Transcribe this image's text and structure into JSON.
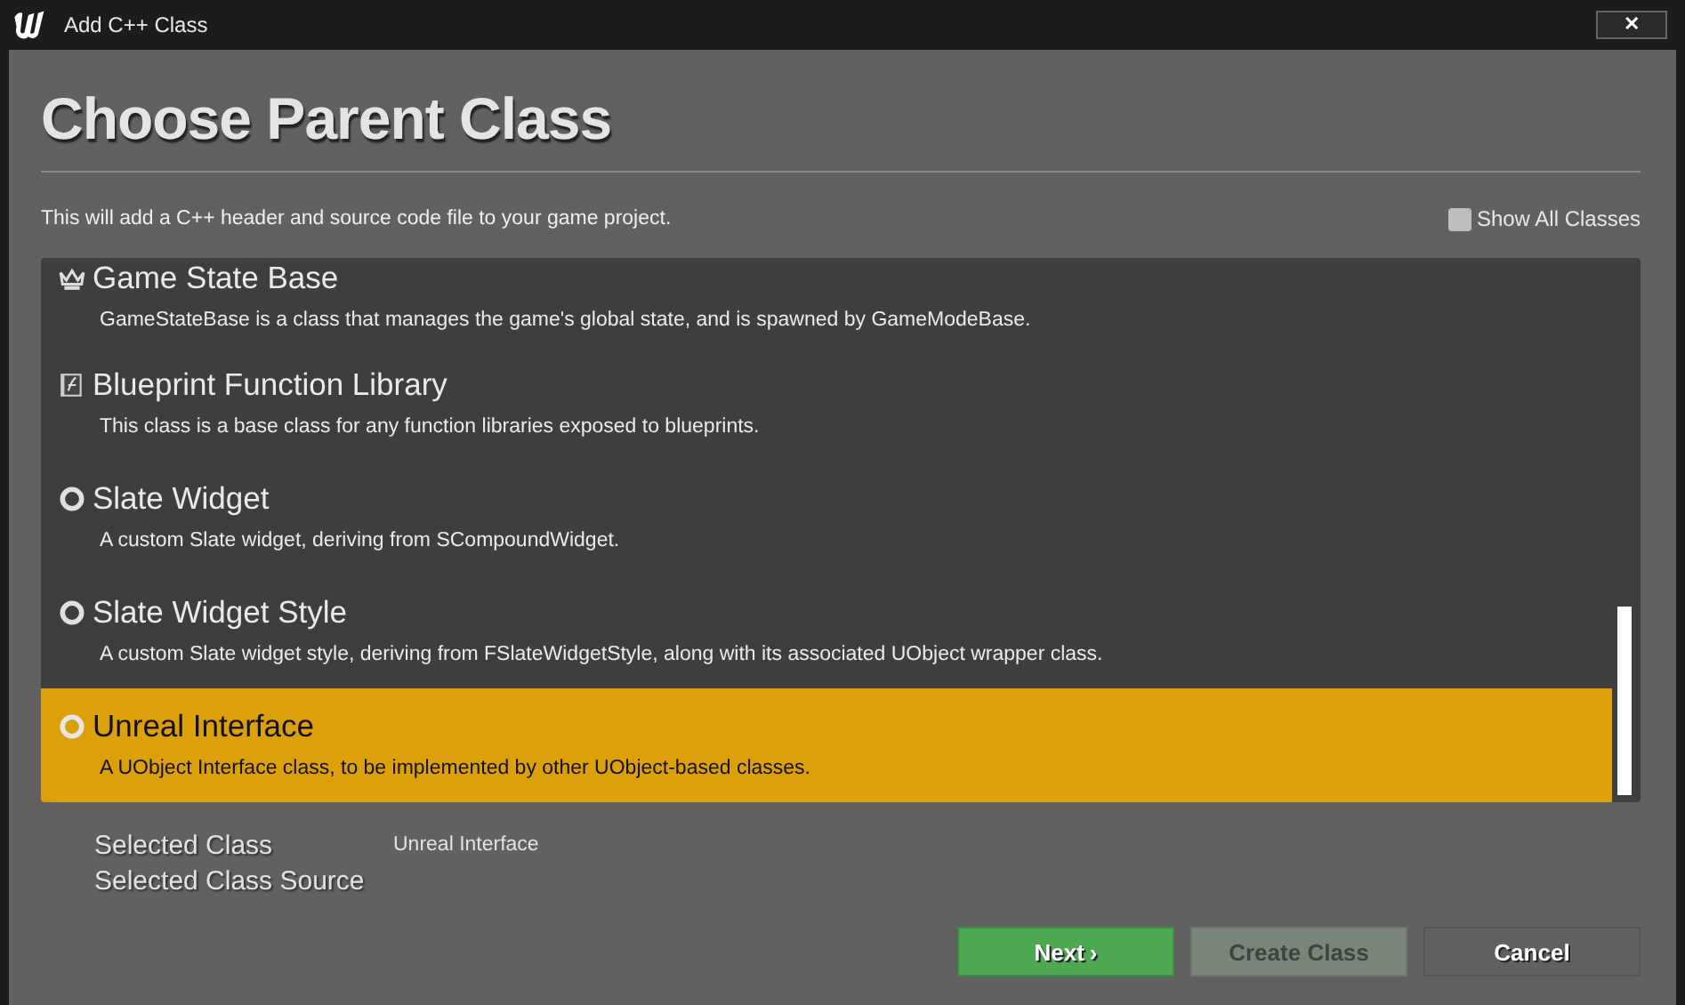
{
  "window": {
    "title": "Add C++ Class",
    "close": "✕"
  },
  "heading": "Choose Parent Class",
  "description": "This will add a C++ header and source code file to your game project.",
  "show_all_classes": {
    "label": "Show All Classes",
    "checked": false
  },
  "classes": [
    {
      "kind": "state",
      "name": "Game State Base",
      "description": "GameStateBase is a class that manages the game's global state, and is spawned by GameModeBase.",
      "selected": false
    },
    {
      "kind": "library",
      "name": "Blueprint Function Library",
      "description": "This class is a base class for any function libraries exposed to blueprints.",
      "selected": false
    },
    {
      "kind": "radio",
      "name": "Slate Widget",
      "description": "A custom Slate widget, deriving from SCompoundWidget.",
      "selected": false
    },
    {
      "kind": "radio",
      "name": "Slate Widget Style",
      "description": "A custom Slate widget style, deriving from FSlateWidgetStyle, along with its associated UObject wrapper class.",
      "selected": false
    },
    {
      "kind": "radio",
      "name": "Unreal Interface",
      "description": "A UObject Interface class, to be implemented by other UObject-based classes.",
      "selected": true
    }
  ],
  "summary": [
    {
      "label": "Selected Class",
      "value": "Unreal Interface"
    },
    {
      "label": "Selected Class Source"
    }
  ],
  "buttons": [
    {
      "kind": "primary",
      "label": "Next",
      "arrow": "›",
      "disabled": false
    },
    {
      "kind": "normal",
      "label": "Create Class",
      "disabled": true
    },
    {
      "kind": "normal",
      "label": "Cancel",
      "disabled": false
    }
  ]
}
